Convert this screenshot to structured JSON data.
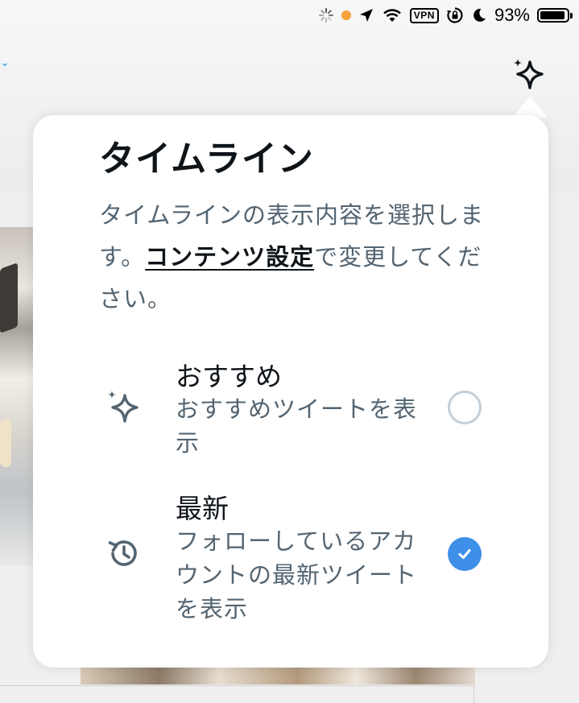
{
  "status_bar": {
    "battery_percent": "93%",
    "vpn_label": "VPN",
    "icons": [
      "loading-spinner-icon",
      "orange-dot-indicator",
      "location-arrow-icon",
      "wifi-icon",
      "vpn-badge",
      "orientation-lock-icon",
      "do-not-disturb-moon-icon",
      "battery-icon"
    ]
  },
  "header": {
    "sparkle_button_icon": "sparkle-icon"
  },
  "popover": {
    "title": "タイムライン",
    "description_before": "タイムラインの表示内容を選択します。",
    "description_link": "コンテンツ設定",
    "description_after": "で変更してください。",
    "options": [
      {
        "title": "おすすめ",
        "subtitle": "おすすめツイートを表示",
        "icon": "sparkle-icon",
        "selected": false
      },
      {
        "title": "最新",
        "subtitle": "フォローしているアカウントの最新ツイートを表示",
        "icon": "history-icon",
        "selected": true
      }
    ]
  },
  "colors": {
    "accent": "#3d8fe8",
    "text_primary": "#0f1419",
    "text_secondary": "#536471",
    "radio_border": "#c4ced6"
  }
}
